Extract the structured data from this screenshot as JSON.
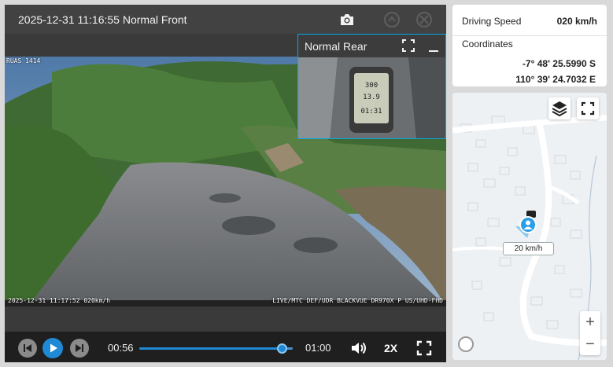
{
  "video": {
    "title": "2025-12-31 11:16:55 Normal Front",
    "front_overlay_top": "RUAS 1414",
    "front_overlay_bottom_left": "2025-12-31 11:17:52 020km/h",
    "front_overlay_bottom_right": "LIVE/MTC DEF/UDR BLACKVUE DR970X P US/UHD-FHD",
    "rear_title": "Normal Rear",
    "rear_gps_readouts": [
      "300",
      "13.9",
      "01:31"
    ]
  },
  "controls": {
    "current_time": "00:56",
    "duration": "01:00",
    "progress_fraction": 0.93,
    "playback_speed": "2X"
  },
  "info": {
    "speed_label": "Driving Speed",
    "speed_value": "020 km/h",
    "coordinates_label": "Coordinates",
    "latitude": "-7° 48' 25.5990 S",
    "longitude": "110° 39' 24.7032 E"
  },
  "map": {
    "speed_tag": "20 km/h",
    "zoom_in": "+",
    "zoom_out": "−"
  },
  "colors": {
    "accent": "#1e8ad6",
    "pip_border": "#00a8e8",
    "header_bg": "#424242",
    "control_bg": "#1f1f1f"
  },
  "icons": {
    "header": [
      "camera-icon",
      "share-icon",
      "fullscreen-off-icon"
    ],
    "controls": [
      "previous-icon",
      "play-icon",
      "next-icon",
      "volume-icon",
      "fullscreen-icon"
    ],
    "map": [
      "layers-icon",
      "fullscreen-icon",
      "vehicle-marker-icon",
      "map-logo-icon"
    ]
  }
}
